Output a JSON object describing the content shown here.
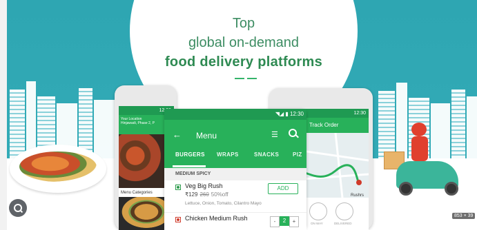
{
  "headline": {
    "line1": "Top",
    "line2": "global on-demand",
    "line3": "food delivery platforms"
  },
  "colors": {
    "teal_bg": "#2fa7b4",
    "brand_green": "#28b15a",
    "headline_green": "#3d8d63"
  },
  "phone_left": {
    "status_time": "12:30",
    "location_label": "Your Location",
    "location_value": "Hinjawadi, Phase 2, P",
    "categories_label": "Menu Categories"
  },
  "phone_center": {
    "status_time": "◥◢ ▮ 12:30",
    "title": "Menu",
    "back_icon": "arrow-left-icon",
    "tabs": [
      "BURGERS",
      "WRAPS",
      "SNACKS",
      "PIZ"
    ],
    "section_label": "MEDIUM SPICY",
    "items": [
      {
        "name": "Veg Big Rush",
        "price": "₹129",
        "old_price": "260",
        "discount": "50%off",
        "description": "Lettuce, Onion, Tomato, Cilantro Mayo",
        "action_label": "ADD",
        "type": "veg"
      },
      {
        "name": "Chicken Medium Rush",
        "quantity": "2",
        "minus_label": "-",
        "plus_label": "+",
        "type": "non-veg"
      }
    ]
  },
  "phone_right": {
    "status_time": "12:30",
    "title": "Track Order",
    "map_label": "Rushrs",
    "steps": [
      "PREPARING",
      "ON WAY",
      "DELIVERED"
    ]
  },
  "overlay": {
    "dims_label": "853 × 39"
  }
}
